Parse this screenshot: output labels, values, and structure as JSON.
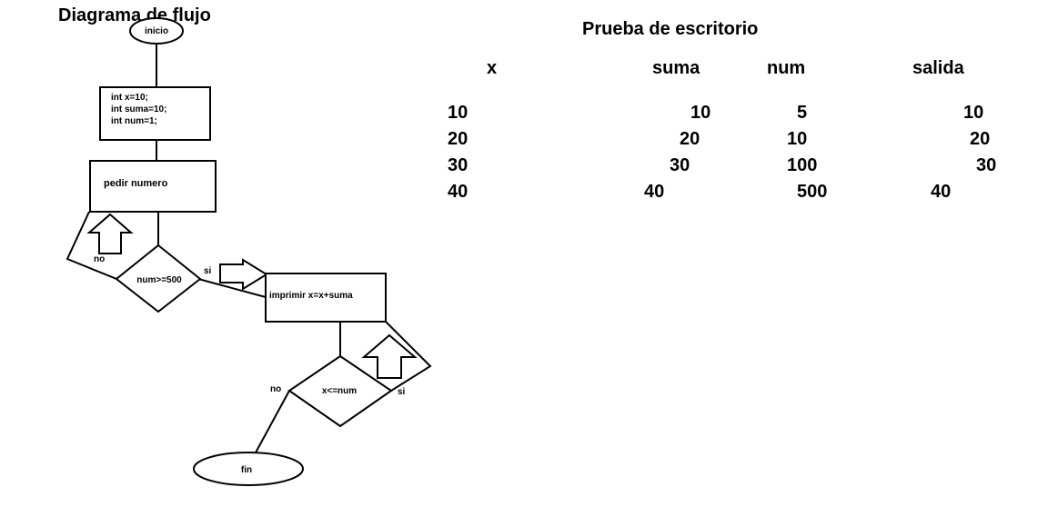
{
  "diagram": {
    "title": "Diagrama de flujo",
    "start_label": "inicio",
    "init_lines": [
      "int x=10;",
      "int suma=10;",
      "int num=1;"
    ],
    "input_label": "pedir numero",
    "decision1_label": "num>=500",
    "decision1_no": "no",
    "decision1_yes": "si",
    "output_label": "imprimir x=x+suma",
    "decision2_label": "x<=num",
    "decision2_no": "no",
    "decision2_yes": "si",
    "end_label": "fin"
  },
  "trace_table": {
    "title": "Prueba de escritorio",
    "headers": [
      "x",
      "suma",
      "num",
      "salida"
    ],
    "rows": [
      [
        "10",
        "10",
        "5",
        "10"
      ],
      [
        "20",
        "20",
        "10",
        "20"
      ],
      [
        "30",
        "30",
        "100",
        "30"
      ],
      [
        "40",
        "40",
        "500",
        "40"
      ]
    ]
  }
}
